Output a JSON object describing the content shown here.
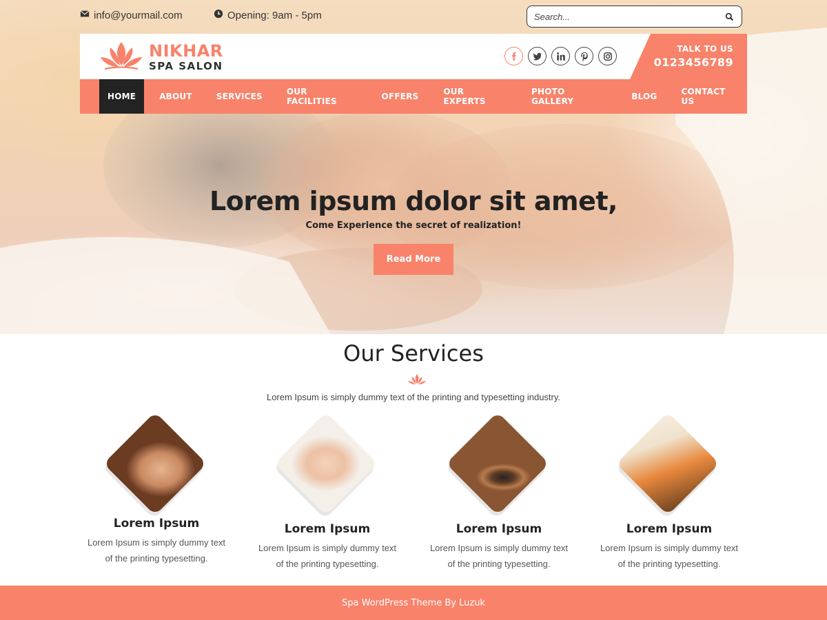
{
  "topbar": {
    "email": "info@yourmail.com",
    "hours": "Opening: 9am - 5pm",
    "search_placeholder": "Search..."
  },
  "header": {
    "logo_name": "NIKHAR",
    "logo_sub": "SPA SALON",
    "socials": [
      "facebook-icon",
      "twitter-icon",
      "linkedin-icon",
      "pinterest-icon",
      "instagram-icon"
    ],
    "talk_label": "TALK TO US",
    "phone": "0123456789"
  },
  "nav": {
    "items": [
      "HOME",
      "ABOUT",
      "SERVICES",
      "OUR FACILITIES",
      "OFFERS",
      "OUR EXPERTS",
      "PHOTO GALLERY",
      "BLOG",
      "CONTACT US"
    ],
    "active": "HOME"
  },
  "hero": {
    "title": "Lorem ipsum dolor sit amet,",
    "subtitle": "Come Experience the secret of realization!",
    "button": "Read More"
  },
  "services": {
    "title": "Our Services",
    "description": "Lorem Ipsum is simply dummy text of the printing and typesetting industry.",
    "items": [
      {
        "title": "Lorem Ipsum",
        "line1": "Lorem Ipsum is simply dummy text",
        "line2": "of the printing typesetting."
      },
      {
        "title": "Lorem Ipsum",
        "line1": "Lorem Ipsum is simply dummy text",
        "line2": "of the printing typesetting."
      },
      {
        "title": "Lorem Ipsum",
        "line1": "Lorem Ipsum is simply dummy text",
        "line2": "of the printing typesetting."
      },
      {
        "title": "Lorem Ipsum",
        "line1": "Lorem Ipsum is simply dummy text",
        "line2": "of the printing typesetting."
      }
    ]
  },
  "footer": {
    "text": "Spa WordPress Theme By Luzuk"
  },
  "colors": {
    "accent": "#f8826a",
    "dark": "#232323"
  }
}
